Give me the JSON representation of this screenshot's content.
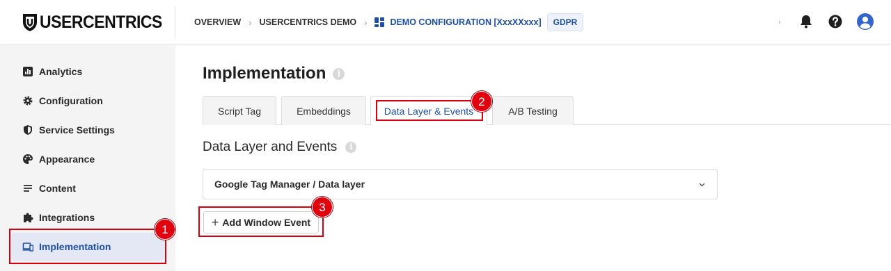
{
  "header": {
    "logo_text": "USERCENTRICS",
    "breadcrumbs": [
      {
        "label": "OVERVIEW"
      },
      {
        "label": "USERCENTRICS DEMO"
      },
      {
        "label": "DEMO CONFIGURATION [XxxXXxxx]"
      }
    ],
    "badge": "GDPR",
    "icons": [
      "bell-icon",
      "help-icon",
      "user-avatar-icon"
    ]
  },
  "sidebar": {
    "items": [
      {
        "label": "Analytics",
        "icon": "analytics-icon"
      },
      {
        "label": "Configuration",
        "icon": "gear-icon"
      },
      {
        "label": "Service Settings",
        "icon": "shield-icon"
      },
      {
        "label": "Appearance",
        "icon": "palette-icon"
      },
      {
        "label": "Content",
        "icon": "content-lines-icon"
      },
      {
        "label": "Integrations",
        "icon": "puzzle-icon"
      },
      {
        "label": "Implementation",
        "icon": "devices-icon",
        "active": true
      }
    ]
  },
  "main": {
    "title": "Implementation",
    "tabs": [
      {
        "label": "Script Tag"
      },
      {
        "label": "Embeddings"
      },
      {
        "label": "Data Layer & Events",
        "active": true
      },
      {
        "label": "A/B Testing"
      }
    ],
    "section_title": "Data Layer and Events",
    "accordion_label": "Google Tag Manager / Data layer",
    "add_button_label": "Add Window Event"
  },
  "annotations": [
    "1",
    "2",
    "3"
  ],
  "colors": {
    "accent": "#1e4fa3",
    "annotation": "#d9000d",
    "sidebar_bg": "#f4f4f4",
    "active_bg": "#e3e8f4"
  }
}
